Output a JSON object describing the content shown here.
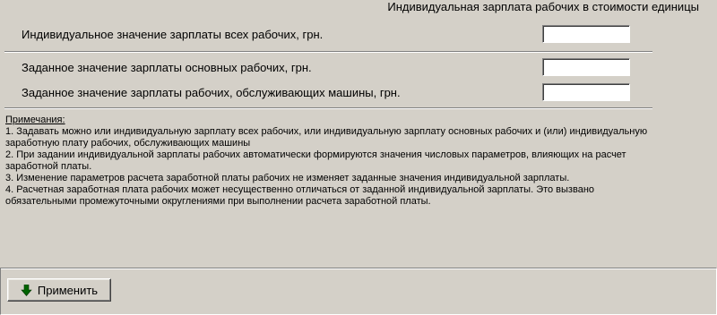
{
  "header": {
    "title": "Индивидуальная зарплата рабочих в стоимости единицы"
  },
  "fields": [
    {
      "label": "Индивидуальное значение зарплаты  всех рабочих, грн.",
      "value": ""
    },
    {
      "label": "Заданное значение зарплаты основных рабочих, грн.",
      "value": ""
    },
    {
      "label": "Заданное значение зарплаты рабочих, обслуживающих машины, грн.",
      "value": ""
    }
  ],
  "notes": {
    "title": "Примечания:",
    "items": [
      "1. Задавать можно или индивидуальную зарплату всех рабочих, или индивидуальную зарплату основных рабочих и (или) индивидуальную заработную плату рабочих, обслуживающих машины",
      "2. При задании индивидуальной зарплаты рабочих автоматически формируются значения числовых параметров, влияющих на расчет заработной платы.",
      "3. Изменение параметров расчета заработной платы рабочих не изменяет заданные значения индивидуальной зарплаты.",
      "4. Расчетная заработная плата рабочих может несущественно отличаться от заданной индивидуальной зарплаты. Это вызвано обязательными промежуточными округлениями при выполнении расчета заработной платы."
    ]
  },
  "toolbar": {
    "apply_label": "Применить",
    "apply_icon": "arrow-down-icon",
    "apply_icon_color": "#006400"
  }
}
